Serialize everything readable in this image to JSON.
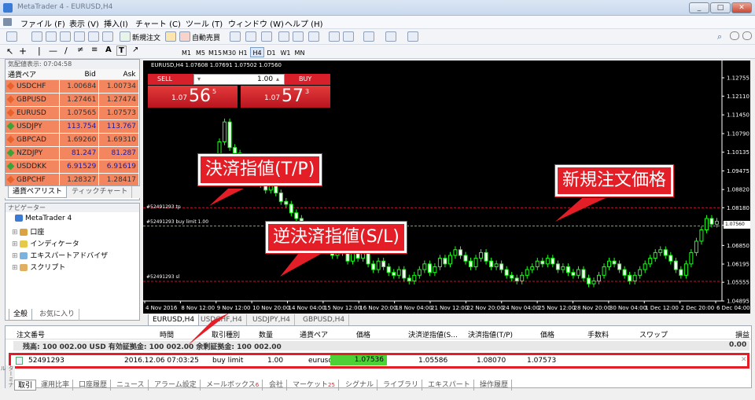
{
  "window": {
    "title": "MetaTrader 4 - EURUSD,H4",
    "min": "_",
    "max": "□",
    "close": "✕"
  },
  "menu": [
    "ファイル (F)",
    "表示 (V)",
    "挿入(I)",
    "チャート (C)",
    "ツール (T)",
    "ウィンドウ (W)",
    "ヘルプ (H)"
  ],
  "toolbar": {
    "new_order": "新規注文",
    "auto_trading": "自動売買"
  },
  "timeframes": [
    "M1",
    "M5",
    "M15",
    "M30",
    "H1",
    "H4",
    "D1",
    "W1",
    "MN"
  ],
  "timeframe_selected": "H4",
  "market_watch": {
    "header": "気配値表示: 07:04:58",
    "columns": [
      "通貨ペア",
      "Bid",
      "Ask"
    ],
    "rows": [
      {
        "symbol": "USDCHF",
        "bid": "1.00684",
        "ask": "1.00734",
        "dir": "down"
      },
      {
        "symbol": "GBPUSD",
        "bid": "1.27461",
        "ask": "1.27474",
        "dir": "down"
      },
      {
        "symbol": "EURUSD",
        "bid": "1.07565",
        "ask": "1.07573",
        "dir": "down"
      },
      {
        "symbol": "USDJPY",
        "bid": "113.754",
        "ask": "113.767",
        "dir": "up"
      },
      {
        "symbol": "GBPCAD",
        "bid": "1.69260",
        "ask": "1.69310",
        "dir": "down"
      },
      {
        "symbol": "NZDJPY",
        "bid": "81.247",
        "ask": "81.287",
        "dir": "up"
      },
      {
        "symbol": "USDDKK",
        "bid": "6.91529",
        "ask": "6.91619",
        "dir": "up"
      },
      {
        "symbol": "GBPCHF",
        "bid": "1.28327",
        "ask": "1.28417",
        "dir": "down"
      }
    ],
    "tabs": [
      "通貨ペアリスト",
      "ティックチャート"
    ]
  },
  "navigator": {
    "header": "ナビゲーター",
    "root": "MetaTrader 4",
    "items": [
      "口座",
      "インディケータ",
      "エキスパートアドバイザ",
      "スクリプト"
    ],
    "tabs": [
      "全般",
      "お気に入り"
    ]
  },
  "chart": {
    "info": "EURUSD,H4  1.07608 1.07691 1.07502 1.07560",
    "one_click": {
      "sell": "SELL",
      "buy": "BUY",
      "lots": "1.00",
      "sell_small": "1.07",
      "sell_big": "56",
      "sell_sup": "5",
      "buy_small": "1.07",
      "buy_big": "57",
      "buy_sup": "3"
    },
    "price_ticks": [
      "1.12755",
      "1.12110",
      "1.11450",
      "1.10790",
      "1.10135",
      "1.09475",
      "1.08820",
      "1.08180",
      "1.07560",
      "1.06850",
      "1.06195",
      "1.05555",
      "1.04895"
    ],
    "date_ticks": [
      "4 Nov 2016",
      "8 Nov 12:00",
      "9 Nov 12:00",
      "10 Nov 20:00",
      "14 Nov 04:00",
      "15 Nov 12:00",
      "16 Nov 20:00",
      "18 Nov 04:00",
      "21 Nov 12:00",
      "22 Nov 20:00",
      "24 Nov 04:00",
      "25 Nov 12:00",
      "28 Nov 20:00",
      "30 Nov 04:00",
      "1 Dec 12:00",
      "2 Dec 20:00",
      "6 Dec 04:00"
    ],
    "lines": {
      "tp": "#52491293 tp",
      "limit": "#52491293 buy limit 1.00",
      "sl": "#52491293 sl"
    },
    "current_price": "1.07560",
    "tabs": [
      "EURUSD,H4",
      "USDCHF,H4",
      "USDJPY,H4",
      "GBPUSD,H4"
    ]
  },
  "callouts": {
    "tp": "決済指値(T/P)",
    "price": "新規注文価格",
    "sl": "逆決済指値(S/L)"
  },
  "terminal": {
    "columns": [
      "注文番号",
      "時間",
      "取引種別",
      "数量",
      "通貨ペア",
      "価格",
      "決済逆指値(S...",
      "決済指値(T/P)",
      "価格",
      "手数料",
      "スワップ",
      "損益"
    ],
    "balance": "残高: 100 002.00 USD  有効証拠金: 100 002.00  余剰証拠金: 100 002.00",
    "balance_pl": "0.00",
    "order": {
      "id": "52491293",
      "time": "2016.12.06 07:03:25",
      "type": "buy limit",
      "lots": "1.00",
      "symbol": "eurusd",
      "price": "1.07536",
      "sl": "1.05586",
      "tp": "1.08070",
      "current": "1.07573"
    },
    "side_label": "ターミナル",
    "tabs": [
      {
        "label": "取引",
        "badge": ""
      },
      {
        "label": "運用比率",
        "badge": ""
      },
      {
        "label": "口座履歴",
        "badge": ""
      },
      {
        "label": "ニュース",
        "badge": ""
      },
      {
        "label": "アラーム設定",
        "badge": ""
      },
      {
        "label": "メールボックス",
        "badge": "6"
      },
      {
        "label": "会社",
        "badge": ""
      },
      {
        "label": "マーケット",
        "badge": "25"
      },
      {
        "label": "シグナル",
        "badge": ""
      },
      {
        "label": "ライブラリ",
        "badge": ""
      },
      {
        "label": "エキスパート",
        "badge": ""
      },
      {
        "label": "操作履歴",
        "badge": ""
      }
    ]
  },
  "colors": {
    "accent_red": "#e41e26",
    "buy_highlight": "#4cd137",
    "up": "#1aff1a",
    "sell_bg": "#d8202a"
  }
}
